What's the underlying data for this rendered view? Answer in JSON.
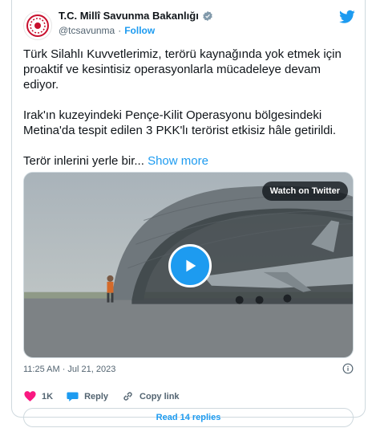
{
  "account": {
    "display_name": "T.C. Millî Savunma Bakanlığı",
    "handle": "@tcsavunma",
    "separator": "·",
    "follow_label": "Follow"
  },
  "tweet": {
    "paragraph_1": "Türk Silahlı Kuvvetlerimiz, terörü kaynağında yok etmek için proaktif ve kesintisiz operasyonlarla mücadeleye devam ediyor.",
    "paragraph_2": "Irak'ın kuzeyindeki Pençe-Kilit Operasyonu bölgesindeki Metina'da tespit edilen 3 PKK'lı terörist etkisiz hâle getirildi.",
    "paragraph_3": "Terör inlerini yerle bir...",
    "show_more_label": "Show more"
  },
  "media": {
    "watch_label": "Watch on Twitter"
  },
  "meta": {
    "timestamp": "11:25 AM · Jul 21, 2023"
  },
  "actions": {
    "like_count": "1K",
    "reply_label": "Reply",
    "copy_link_label": "Copy link"
  },
  "read_replies_label": "Read 14 replies",
  "colors": {
    "accent": "#1d9bf0",
    "like": "#f91880",
    "text": "#0f1419",
    "muted": "#536471",
    "border": "#cfd9de"
  }
}
